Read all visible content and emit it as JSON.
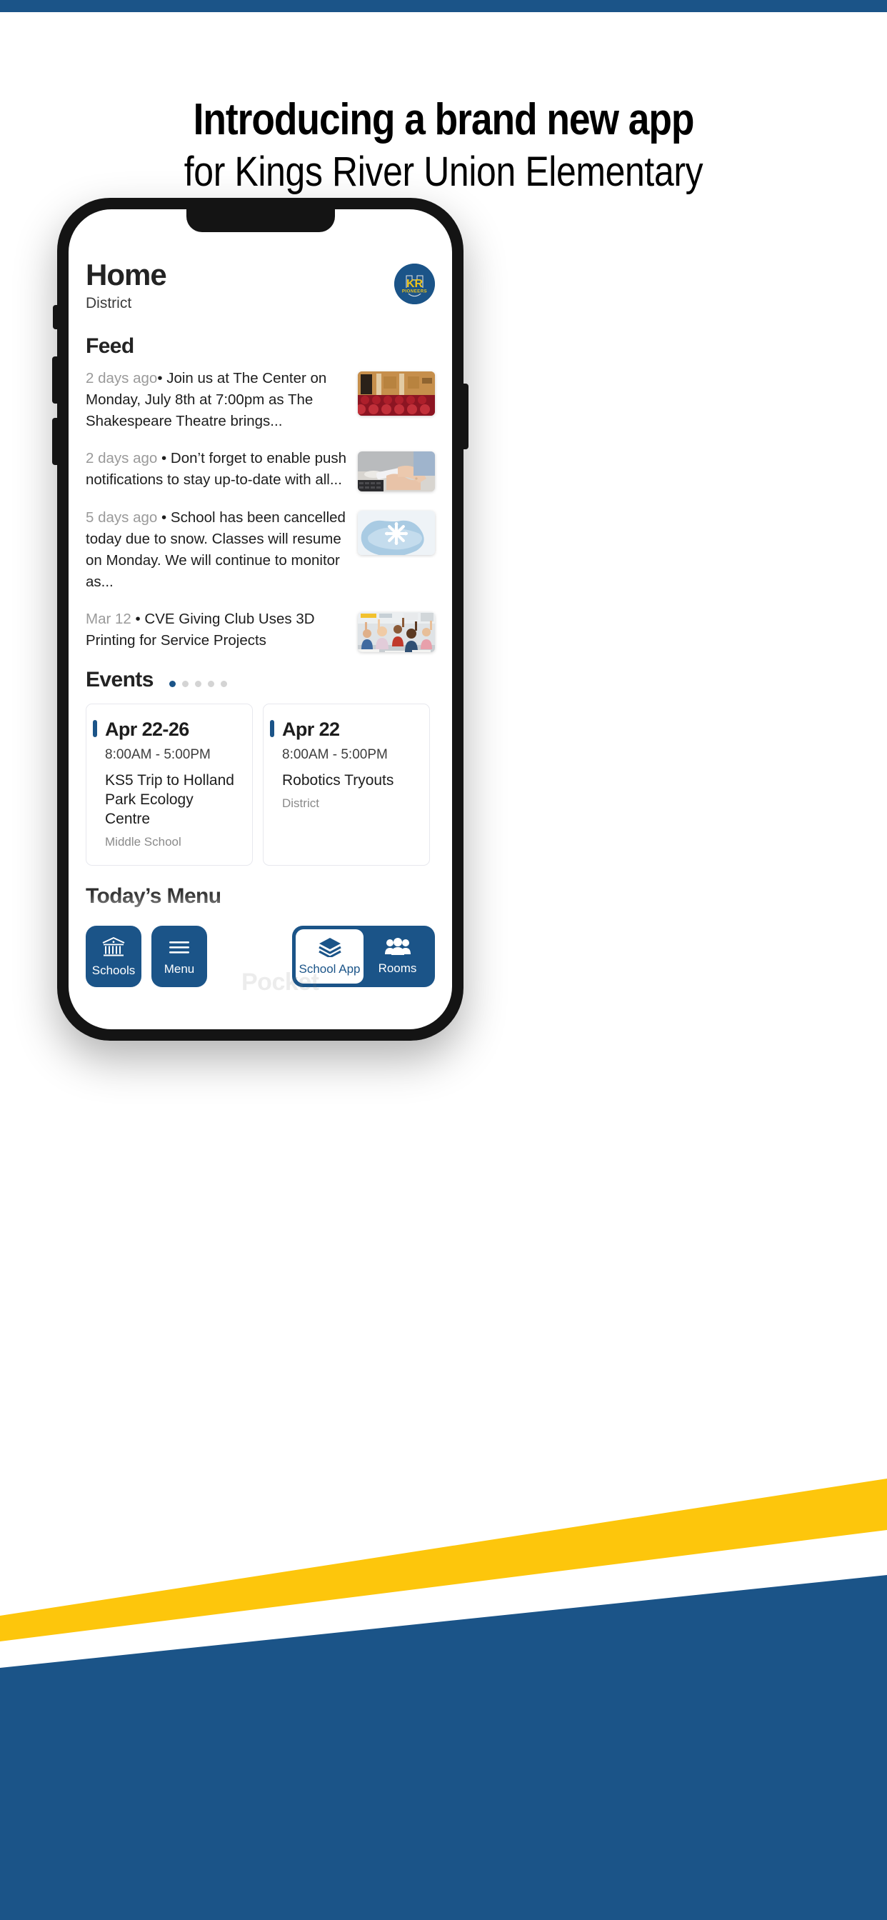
{
  "palette": {
    "brand_blue": "#1B5488",
    "accent_yellow": "#FDC60C",
    "white": "#FFFFFF",
    "phone_frame": "#141414",
    "muted_text": "#9A9A9A"
  },
  "promo": {
    "headline_line1": "Introducing a brand new app",
    "headline_line2": "for Kings River Union Elementary"
  },
  "app": {
    "header": {
      "title": "Home",
      "subtitle": "District",
      "logo_text_top": "KR",
      "logo_text_bottom": "PIONEERS"
    },
    "feed": {
      "section_title": "Feed",
      "items": [
        {
          "time": "2 days ago",
          "separator": "•",
          "text": "Join us at The Center on Monday, July 8th at 7:00pm as The Shakespeare Theatre brings...",
          "thumbnail": "theatre-auditorium-photo"
        },
        {
          "time": "2 days ago",
          "separator": "•",
          "text": "Don’t forget to enable push notifications to stay up-to-date with all...",
          "thumbnail": "hands-holding-phone-photo"
        },
        {
          "time": "5 days ago",
          "separator": "•",
          "text": "School has been cancelled today due to snow. Classes will resume on Monday. We will continue to monitor as...",
          "thumbnail": "snowflake-mittens-photo"
        },
        {
          "time": "Mar 12",
          "separator": "•",
          "text": "CVE Giving Club Uses 3D Printing for Service Projects",
          "thumbnail": "classroom-students-photo"
        }
      ]
    },
    "events": {
      "section_title": "Events",
      "pagination": {
        "total": 5,
        "active_index": 0
      },
      "cards": [
        {
          "date": "Apr 22-26",
          "time": "8:00AM  -  5:00PM",
          "name": "KS5 Trip to Holland Park Ecology Centre",
          "location": "Middle School"
        },
        {
          "date": "Apr 22",
          "time": "8:00AM  -  5:00PM",
          "name": "Robotics Tryouts",
          "location": "District"
        }
      ]
    },
    "menu": {
      "section_title": "Today’s Menu"
    },
    "bottom_nav": {
      "left_items": [
        {
          "label": "Schools",
          "icon": "bank-columns-icon"
        },
        {
          "label": "Menu",
          "icon": "hamburger-menu-icon"
        }
      ],
      "right_items": [
        {
          "label": "School App",
          "icon": "layers-stack-icon",
          "active": true
        },
        {
          "label": "Rooms",
          "icon": "people-group-icon",
          "active": false
        }
      ]
    },
    "background_watermark": "Pocket"
  }
}
